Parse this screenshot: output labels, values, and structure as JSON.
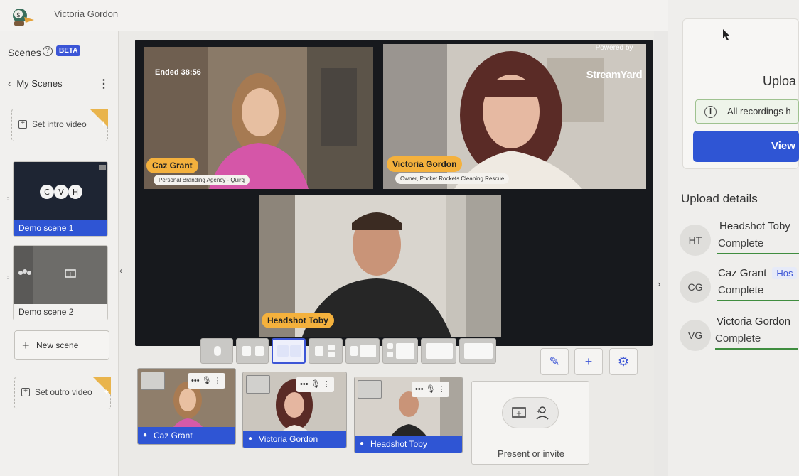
{
  "topbar": {
    "user_name": "Victoria Gordon"
  },
  "sidebar": {
    "title": "Scenes",
    "badge": "BETA",
    "back_label": "My Scenes",
    "intro_label": "Set intro video",
    "scenes": [
      {
        "label": "Demo scene 1",
        "initials": [
          "C",
          "V",
          "H"
        ]
      },
      {
        "label": "Demo scene 2"
      }
    ],
    "new_scene_label": "New scene",
    "outro_label": "Set outro video"
  },
  "stage": {
    "ended_label": "Ended 38:56",
    "powered_by": "Powered by",
    "brand": "StreamYard",
    "participants": [
      {
        "name": "Caz Grant",
        "subtitle": "Personal Branding Agency - Quirq"
      },
      {
        "name": "Victoria Gordon",
        "subtitle": "Owner, Pocket Rockets Cleaning Rescue"
      },
      {
        "name": "Headshot Toby",
        "subtitle": ""
      }
    ]
  },
  "guests": [
    {
      "name": "Caz Grant"
    },
    {
      "name": "Victoria Gordon"
    },
    {
      "name": "Headshot Toby"
    }
  ],
  "present": {
    "label": "Present or invite"
  },
  "upload": {
    "title": "Uploa",
    "notice": "All recordings h",
    "view_label": "View",
    "details_title": "Upload details",
    "rows": [
      {
        "initials": "HT",
        "name": "Headshot Toby",
        "status": "Complete",
        "badge": ""
      },
      {
        "initials": "CG",
        "name": "Caz Grant",
        "status": "Complete",
        "badge": "Hos"
      },
      {
        "initials": "VG",
        "name": "Victoria Gordon",
        "status": "Complete",
        "badge": ""
      }
    ]
  },
  "colors": {
    "accent": "#2f55d4",
    "name_tag": "#f4b13d",
    "complete": "#3f8d3f"
  }
}
